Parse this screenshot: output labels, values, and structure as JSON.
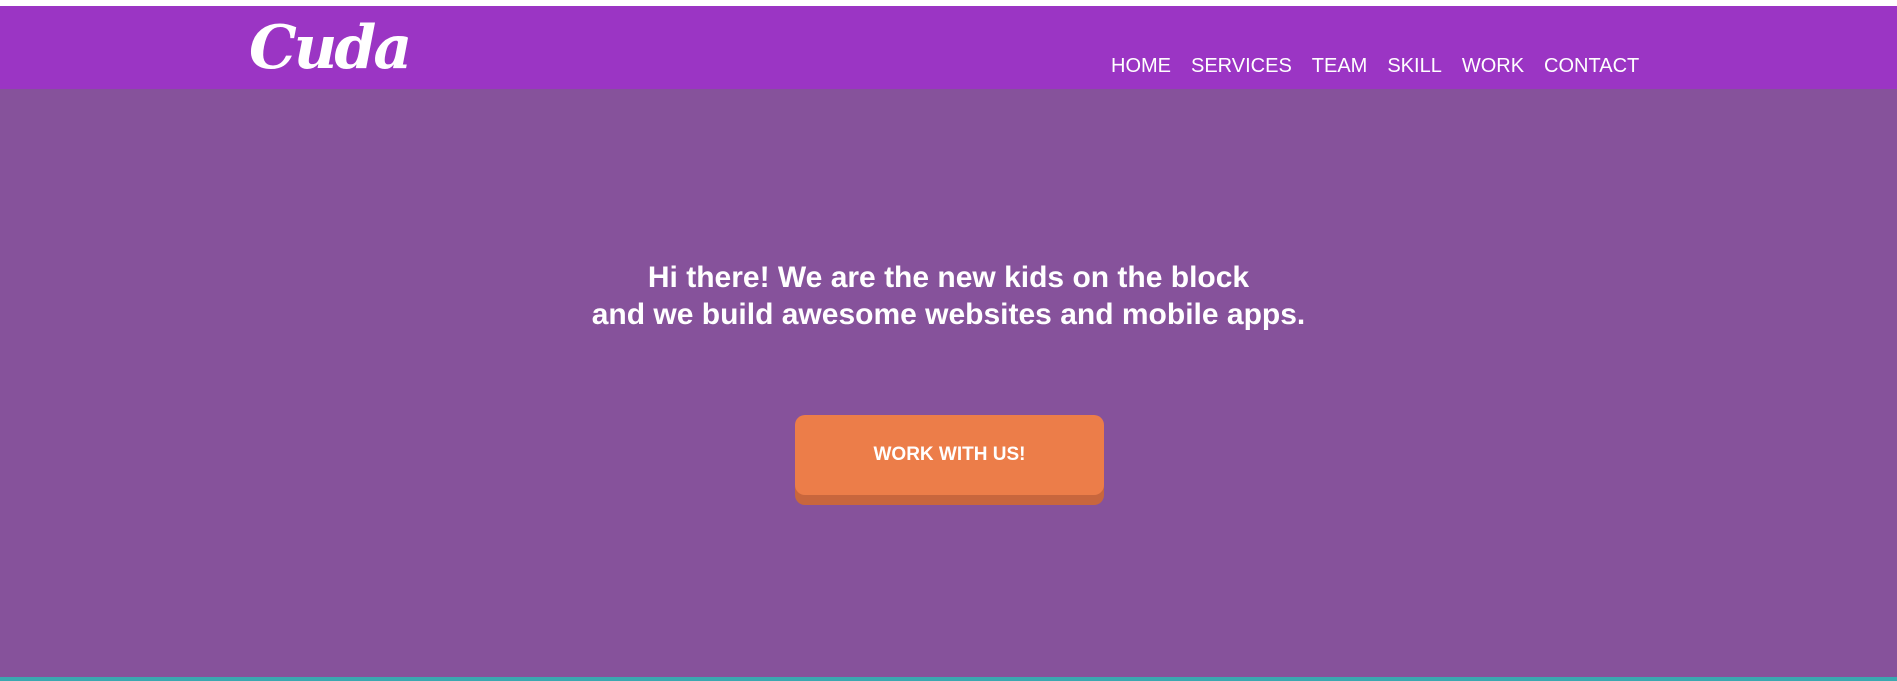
{
  "brand": {
    "logo_text": "Cuda"
  },
  "nav": {
    "items": [
      "HOME",
      "SERVICES",
      "TEAM",
      "SKILL",
      "WORK",
      "CONTACT"
    ]
  },
  "hero": {
    "heading_line1": "Hi there! We are the new kids on the block",
    "heading_line2": "and we build awesome websites and mobile apps.",
    "cta_label": "WORK WITH US!"
  },
  "colors": {
    "navbar": "#9b35c4",
    "hero_background": "#86529b",
    "cta": "#ec7d49",
    "cta_shadow": "#c8663d",
    "bottom_bar": "#3aa8b0"
  }
}
